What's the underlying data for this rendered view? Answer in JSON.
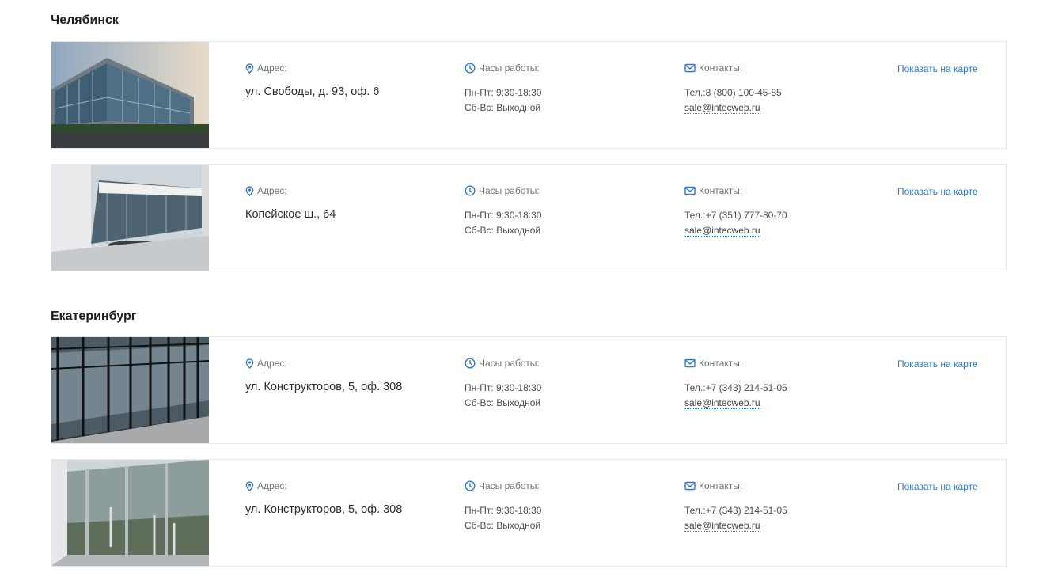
{
  "labels": {
    "address": "Адрес:",
    "hours": "Часы работы:",
    "contacts": "Контакты:",
    "show_on_map": "Показать на карте",
    "phone_prefix": "Тел.:"
  },
  "colors": {
    "accent": "#2f78d8",
    "border": "#e6e8eb",
    "muted": "#6f7378"
  },
  "cities": [
    {
      "name": "Челябинск",
      "offices": [
        {
          "address": "ул. Свободы, д. 93, оф. 6",
          "hours_weekdays": "Пн-Пт: 9:30-18:30",
          "hours_weekend": "Сб-Вс: Выходной",
          "phone": "Тел.:8 (800) 100-45-85",
          "email": "sale@intecweb.ru"
        },
        {
          "address": "Копейское ш., 64",
          "hours_weekdays": "Пн-Пт: 9:30-18:30",
          "hours_weekend": "Сб-Вс: Выходной",
          "phone": "Тел.:+7 (351) 777-80-70",
          "email": "sale@intecweb.ru"
        }
      ]
    },
    {
      "name": "Екатеринбург",
      "offices": [
        {
          "address": "ул. Конструкторов, 5, оф. 308",
          "hours_weekdays": "Пн-Пт: 9:30-18:30",
          "hours_weekend": "Сб-Вс: Выходной",
          "phone": "Тел.:+7 (343) 214-51-05",
          "email": "sale@intecweb.ru"
        },
        {
          "address": "ул. Конструкторов, 5, оф. 308",
          "hours_weekdays": "Пн-Пт: 9:30-18:30",
          "hours_weekend": "Сб-Вс: Выходной",
          "phone": "Тел.:+7 (343) 214-51-05",
          "email": "sale@intecweb.ru"
        }
      ]
    }
  ]
}
